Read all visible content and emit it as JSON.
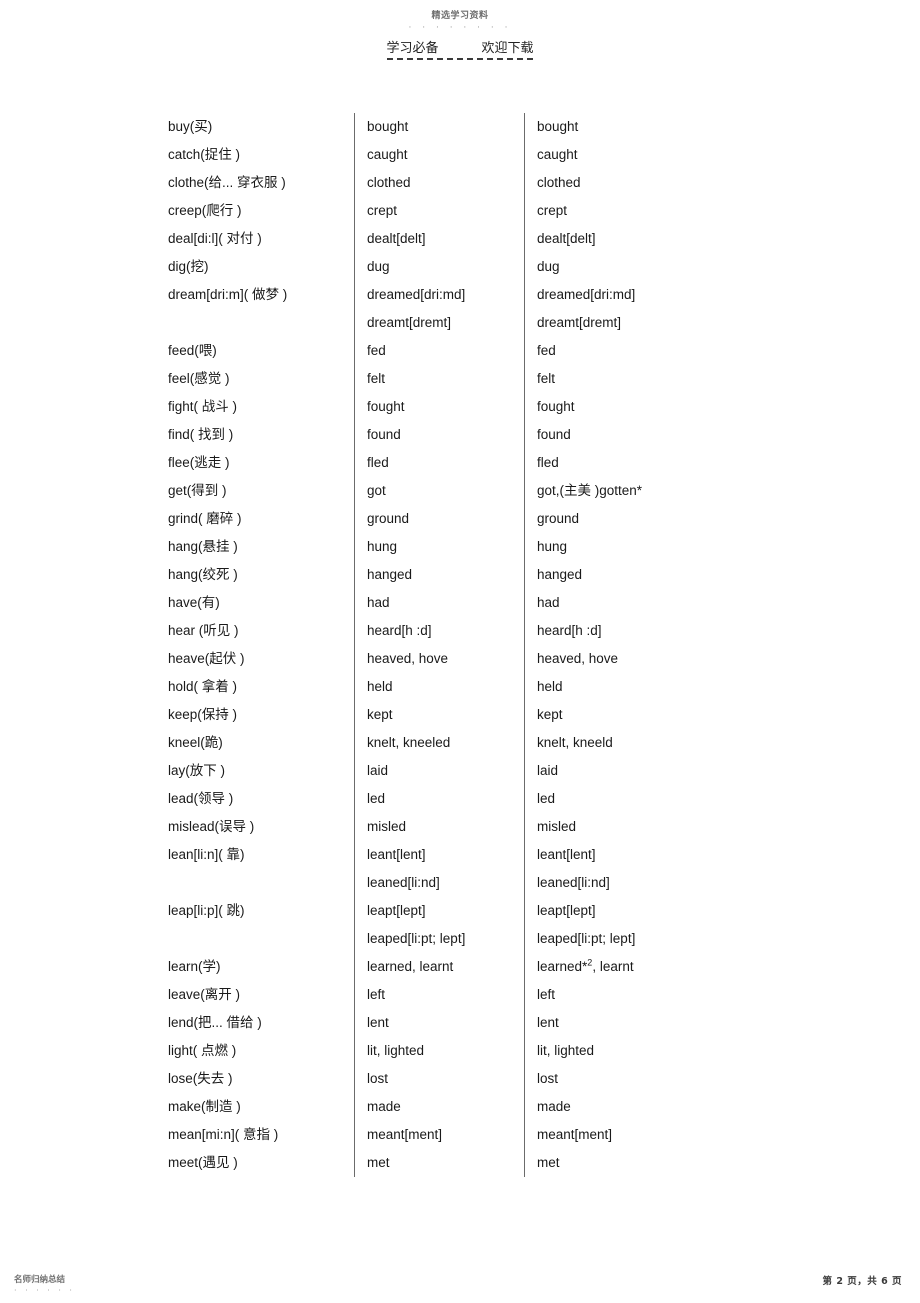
{
  "watermark": {
    "top_text": "精选学习资料",
    "top_dots": "· · · · · · · ·",
    "footer_text": "名师归纳总结",
    "footer_dots": "· · · · · ·"
  },
  "header": {
    "left_label": "学习必备",
    "right_label": "欢迎下载"
  },
  "footer": {
    "page_indicator": "第 2 页，共 6 页"
  },
  "table": {
    "columns": [
      "infinitive",
      "past_tense",
      "past_participle"
    ],
    "rows": [
      {
        "c1": "buy(买)",
        "c2": "bought",
        "c3": "bought"
      },
      {
        "c1": "catch(捉住 )",
        "c2": "caught",
        "c3": "caught"
      },
      {
        "c1": "clothe(给... 穿衣服  )",
        "c2": "clothed",
        "c3": "clothed"
      },
      {
        "c1": "creep(爬行 )",
        "c2": "crept",
        "c3": "crept"
      },
      {
        "c1": "deal[di:l]( 对付 )",
        "c2": "dealt[delt]",
        "c3": "dealt[delt]"
      },
      {
        "c1": "dig(挖)",
        "c2": "dug",
        "c3": "dug"
      },
      {
        "c1": "dream[dri:m]( 做梦 )",
        "c2": "dreamed[dri:md]",
        "c3": "dreamed[dri:md]"
      },
      {
        "c1": "",
        "c2": "dreamt[dremt]",
        "c3": "dreamt[dremt]"
      },
      {
        "c1": "feed(喂)",
        "c2": "fed",
        "c3": "fed"
      },
      {
        "c1": "feel(感觉 )",
        "c2": "felt",
        "c3": "felt"
      },
      {
        "c1": "fight( 战斗 )",
        "c2": "fought",
        "c3": "fought"
      },
      {
        "c1": "find( 找到 )",
        "c2": "found",
        "c3": "found"
      },
      {
        "c1": "flee(逃走 )",
        "c2": "fled",
        "c3": "fled"
      },
      {
        "c1": "get(得到 )",
        "c2": "got",
        "c3": "got,(主美 )gotten*"
      },
      {
        "c1": "grind( 磨碎 )",
        "c2": "ground",
        "c3": "ground"
      },
      {
        "c1": "hang(悬挂 )",
        "c2": "hung",
        "c3": "hung"
      },
      {
        "c1": "hang(绞死 )",
        "c2": "hanged",
        "c3": "hanged"
      },
      {
        "c1": "have(有)",
        "c2": "had",
        "c3": "had"
      },
      {
        "c1": "hear (听见 )",
        "c2": "heard[h   :d]",
        "c3": "heard[h   :d]"
      },
      {
        "c1": "heave(起伏 )",
        "c2": "heaved, hove",
        "c3": "heaved, hove"
      },
      {
        "c1": "hold( 拿着 )",
        "c2": "held",
        "c3": "held"
      },
      {
        "c1": "keep(保持 )",
        "c2": "kept",
        "c3": "kept"
      },
      {
        "c1": "kneel(跪)",
        "c2": "knelt, kneeled",
        "c3": "knelt, kneeld"
      },
      {
        "c1": "lay(放下 )",
        "c2": "laid",
        "c3": "laid"
      },
      {
        "c1": "lead(领导 )",
        "c2": "led",
        "c3": "led"
      },
      {
        "c1": "mislead(误导 )",
        "c2": "misled",
        "c3": "misled"
      },
      {
        "c1": "lean[li:n]( 靠)",
        "c2": "leant[lent]",
        "c3": "leant[lent]"
      },
      {
        "c1": "",
        "c2": "leaned[li:nd]",
        "c3": "leaned[li:nd]"
      },
      {
        "c1": "leap[li:p]( 跳)",
        "c2": "leapt[lept]",
        "c3": "leapt[lept]"
      },
      {
        "c1": "",
        "c2": "leaped[li:pt; lept]",
        "c3": "leaped[li:pt; lept]"
      },
      {
        "c1": "learn(学)",
        "c2": "learned, learnt",
        "c3": "learned*|2|, learnt"
      },
      {
        "c1": "leave(离开 )",
        "c2": "left",
        "c3": "left"
      },
      {
        "c1": "lend(把... 借给 )",
        "c2": "lent",
        "c3": "lent"
      },
      {
        "c1": "light( 点燃 )",
        "c2": "lit, lighted",
        "c3": "lit, lighted"
      },
      {
        "c1": "lose(失去 )",
        "c2": "lost",
        "c3": "lost"
      },
      {
        "c1": "make(制造 )",
        "c2": "made",
        "c3": "made"
      },
      {
        "c1": "mean[mi:n]( 意指 )",
        "c2": "meant[ment]",
        "c3": "meant[ment]"
      },
      {
        "c1": "meet(遇见 )",
        "c2": "met",
        "c3": "met"
      }
    ]
  }
}
